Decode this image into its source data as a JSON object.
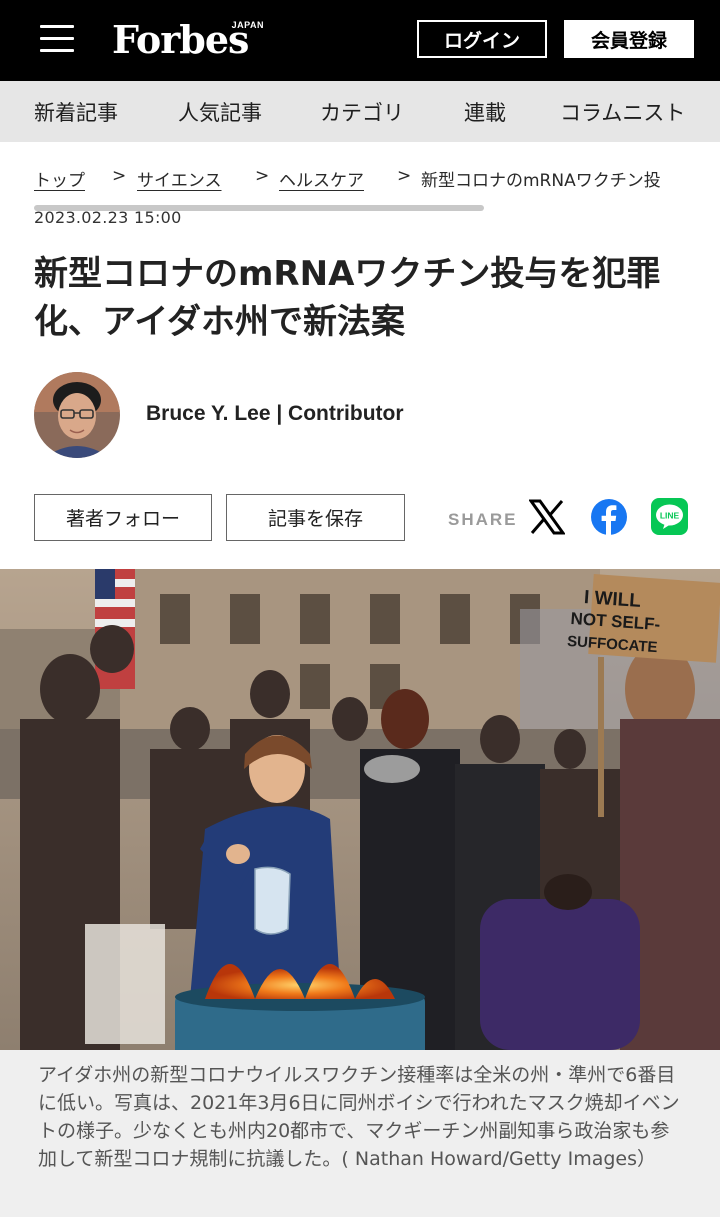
{
  "header": {
    "logo_text": "Forbes",
    "logo_sub": "JAPAN",
    "login_label": "ログイン",
    "register_label": "会員登録"
  },
  "nav": {
    "items": [
      "新着記事",
      "人気記事",
      "カテゴリ",
      "連載",
      "コラムニスト"
    ]
  },
  "breadcrumb": {
    "items": [
      "トップ",
      "サイエンス",
      "ヘルスケア"
    ],
    "separator": ">",
    "current": "新型コロナのmRNAワクチン投"
  },
  "article": {
    "date": "2023.02.23 15:00",
    "title": "新型コロナのmRNAワクチン投与を犯罪化、アイダホ州で新法案",
    "author": "Bruce Y. Lee | Contributor",
    "follow_label": "著者フォロー",
    "save_label": "記事を保存",
    "share_label": "SHARE",
    "photo_sign_text": "I WILL NOT SELF-SUFFOCATE",
    "caption": "アイダホ州の新型コロナウイルスワクチン接種率は全米の州・準州で6番目に低い。写真は、2021年3月6日に同州ボイシで行われたマスク焼却イベントの様子。少なくとも州内20都市で、マクギーチン州副知事ら政治家も参加して新型コロナ規制に抗議した。( Nathan Howard/Getty Images）"
  },
  "colors": {
    "header_bg": "#000000",
    "nav_bg": "#e6e6e6",
    "facebook": "#1877f2",
    "line": "#06c755",
    "caption_bg": "#efefef"
  }
}
